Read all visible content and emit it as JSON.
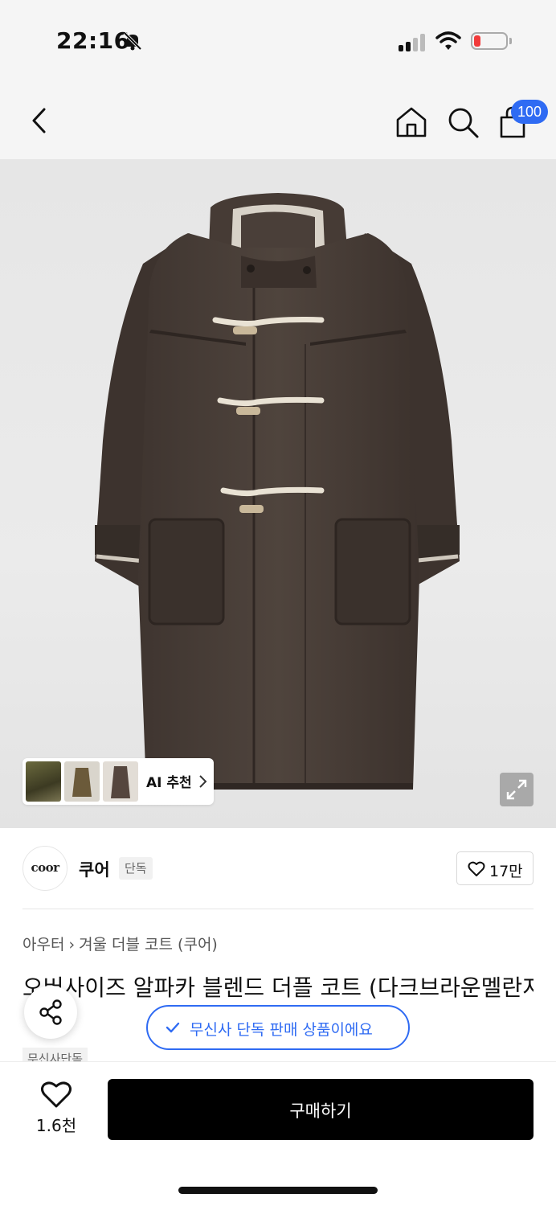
{
  "status_bar": {
    "time": "22:16",
    "battery_color": "#f23b3b"
  },
  "nav": {
    "cart_count": "100",
    "badge_color": "#2f6bf3",
    "icons": [
      "back-icon",
      "home-icon",
      "search-icon",
      "cart-icon"
    ]
  },
  "gallery": {
    "ai_label": "AI 추천"
  },
  "brand": {
    "logo_text": "coor",
    "name": "쿠어",
    "tag": "단독",
    "likes": "17만"
  },
  "product": {
    "breadcrumb": [
      "아우터",
      "겨울 더블 코트 (쿠어)"
    ],
    "title": "오버사이즈 알파카 블렌드 더플 코트 (다크브라운멜란지)",
    "exclusive_tag": "무신사단독"
  },
  "toast": {
    "text": "무신사 단독 판매 상품이에요"
  },
  "bottom_bar": {
    "wish_count": "1.6천",
    "buy_label": "구매하기"
  }
}
